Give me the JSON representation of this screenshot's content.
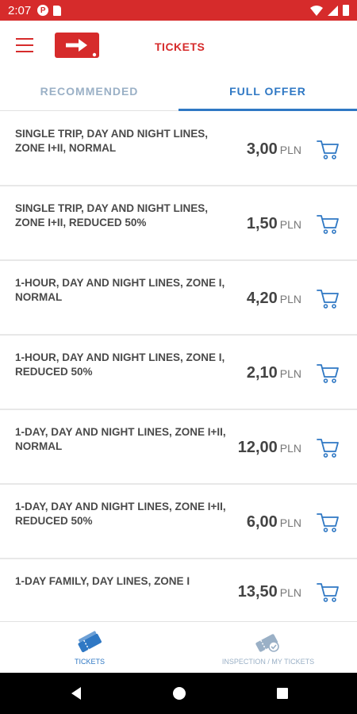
{
  "status_bar": {
    "time": "2:07",
    "icons": [
      "notification-icon",
      "sd-card-icon",
      "wifi-icon",
      "signal-icon",
      "battery-icon"
    ],
    "color": "#d62b2b"
  },
  "app_bar": {
    "title": "TICKETS",
    "logo": "arrow-logo"
  },
  "tabs": [
    {
      "label": "RECOMMENDED",
      "active": false
    },
    {
      "label": "FULL OFFER",
      "active": true
    }
  ],
  "tickets": [
    {
      "title": "SINGLE TRIP, DAY AND NIGHT LINES, ZONE I+II, NORMAL",
      "price": "3,00",
      "currency": "PLN"
    },
    {
      "title": "SINGLE TRIP, DAY AND NIGHT LINES, ZONE I+II, REDUCED 50%",
      "price": "1,50",
      "currency": "PLN"
    },
    {
      "title": "1-HOUR, DAY AND NIGHT LINES, ZONE I, NORMAL",
      "price": "4,20",
      "currency": "PLN"
    },
    {
      "title": "1-HOUR, DAY AND NIGHT LINES, ZONE I, REDUCED 50%",
      "price": "2,10",
      "currency": "PLN"
    },
    {
      "title": "1-DAY, DAY AND NIGHT LINES, ZONE I+II, NORMAL",
      "price": "12,00",
      "currency": "PLN"
    },
    {
      "title": "1-DAY, DAY AND NIGHT LINES, ZONE I+II, REDUCED 50%",
      "price": "6,00",
      "currency": "PLN"
    },
    {
      "title": "1-DAY FAMILY, DAY LINES, ZONE I",
      "price": "13,50",
      "currency": "PLN"
    }
  ],
  "bottom_nav": [
    {
      "label": "TICKETS",
      "icon": "tickets-icon",
      "active": true
    },
    {
      "label": "INSPECTION / MY TICKETS",
      "icon": "inspection-icon",
      "active": false
    }
  ],
  "colors": {
    "brand_red": "#d62b2b",
    "accent_blue": "#2f78c4",
    "inactive_blue": "#9ab0c6"
  }
}
